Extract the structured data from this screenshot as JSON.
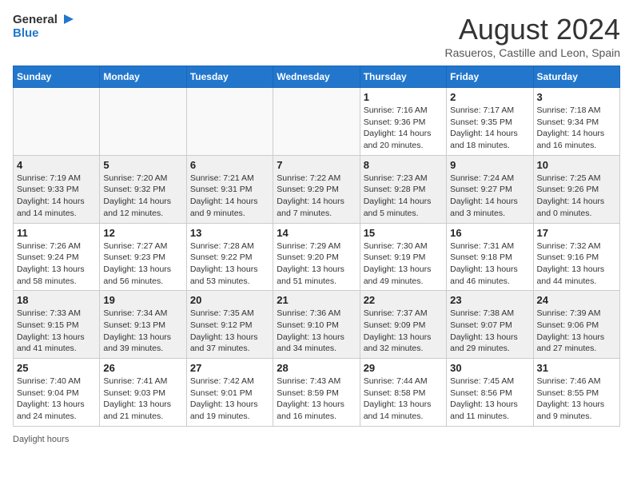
{
  "header": {
    "logo_general": "General",
    "logo_blue": "Blue",
    "month_year": "August 2024",
    "location": "Rasueros, Castille and Leon, Spain"
  },
  "days_of_week": [
    "Sunday",
    "Monday",
    "Tuesday",
    "Wednesday",
    "Thursday",
    "Friday",
    "Saturday"
  ],
  "weeks": [
    [
      {
        "day": "",
        "info": ""
      },
      {
        "day": "",
        "info": ""
      },
      {
        "day": "",
        "info": ""
      },
      {
        "day": "",
        "info": ""
      },
      {
        "day": "1",
        "info": "Sunrise: 7:16 AM\nSunset: 9:36 PM\nDaylight: 14 hours\nand 20 minutes."
      },
      {
        "day": "2",
        "info": "Sunrise: 7:17 AM\nSunset: 9:35 PM\nDaylight: 14 hours\nand 18 minutes."
      },
      {
        "day": "3",
        "info": "Sunrise: 7:18 AM\nSunset: 9:34 PM\nDaylight: 14 hours\nand 16 minutes."
      }
    ],
    [
      {
        "day": "4",
        "info": "Sunrise: 7:19 AM\nSunset: 9:33 PM\nDaylight: 14 hours\nand 14 minutes."
      },
      {
        "day": "5",
        "info": "Sunrise: 7:20 AM\nSunset: 9:32 PM\nDaylight: 14 hours\nand 12 minutes."
      },
      {
        "day": "6",
        "info": "Sunrise: 7:21 AM\nSunset: 9:31 PM\nDaylight: 14 hours\nand 9 minutes."
      },
      {
        "day": "7",
        "info": "Sunrise: 7:22 AM\nSunset: 9:29 PM\nDaylight: 14 hours\nand 7 minutes."
      },
      {
        "day": "8",
        "info": "Sunrise: 7:23 AM\nSunset: 9:28 PM\nDaylight: 14 hours\nand 5 minutes."
      },
      {
        "day": "9",
        "info": "Sunrise: 7:24 AM\nSunset: 9:27 PM\nDaylight: 14 hours\nand 3 minutes."
      },
      {
        "day": "10",
        "info": "Sunrise: 7:25 AM\nSunset: 9:26 PM\nDaylight: 14 hours\nand 0 minutes."
      }
    ],
    [
      {
        "day": "11",
        "info": "Sunrise: 7:26 AM\nSunset: 9:24 PM\nDaylight: 13 hours\nand 58 minutes."
      },
      {
        "day": "12",
        "info": "Sunrise: 7:27 AM\nSunset: 9:23 PM\nDaylight: 13 hours\nand 56 minutes."
      },
      {
        "day": "13",
        "info": "Sunrise: 7:28 AM\nSunset: 9:22 PM\nDaylight: 13 hours\nand 53 minutes."
      },
      {
        "day": "14",
        "info": "Sunrise: 7:29 AM\nSunset: 9:20 PM\nDaylight: 13 hours\nand 51 minutes."
      },
      {
        "day": "15",
        "info": "Sunrise: 7:30 AM\nSunset: 9:19 PM\nDaylight: 13 hours\nand 49 minutes."
      },
      {
        "day": "16",
        "info": "Sunrise: 7:31 AM\nSunset: 9:18 PM\nDaylight: 13 hours\nand 46 minutes."
      },
      {
        "day": "17",
        "info": "Sunrise: 7:32 AM\nSunset: 9:16 PM\nDaylight: 13 hours\nand 44 minutes."
      }
    ],
    [
      {
        "day": "18",
        "info": "Sunrise: 7:33 AM\nSunset: 9:15 PM\nDaylight: 13 hours\nand 41 minutes."
      },
      {
        "day": "19",
        "info": "Sunrise: 7:34 AM\nSunset: 9:13 PM\nDaylight: 13 hours\nand 39 minutes."
      },
      {
        "day": "20",
        "info": "Sunrise: 7:35 AM\nSunset: 9:12 PM\nDaylight: 13 hours\nand 37 minutes."
      },
      {
        "day": "21",
        "info": "Sunrise: 7:36 AM\nSunset: 9:10 PM\nDaylight: 13 hours\nand 34 minutes."
      },
      {
        "day": "22",
        "info": "Sunrise: 7:37 AM\nSunset: 9:09 PM\nDaylight: 13 hours\nand 32 minutes."
      },
      {
        "day": "23",
        "info": "Sunrise: 7:38 AM\nSunset: 9:07 PM\nDaylight: 13 hours\nand 29 minutes."
      },
      {
        "day": "24",
        "info": "Sunrise: 7:39 AM\nSunset: 9:06 PM\nDaylight: 13 hours\nand 27 minutes."
      }
    ],
    [
      {
        "day": "25",
        "info": "Sunrise: 7:40 AM\nSunset: 9:04 PM\nDaylight: 13 hours\nand 24 minutes."
      },
      {
        "day": "26",
        "info": "Sunrise: 7:41 AM\nSunset: 9:03 PM\nDaylight: 13 hours\nand 21 minutes."
      },
      {
        "day": "27",
        "info": "Sunrise: 7:42 AM\nSunset: 9:01 PM\nDaylight: 13 hours\nand 19 minutes."
      },
      {
        "day": "28",
        "info": "Sunrise: 7:43 AM\nSunset: 8:59 PM\nDaylight: 13 hours\nand 16 minutes."
      },
      {
        "day": "29",
        "info": "Sunrise: 7:44 AM\nSunset: 8:58 PM\nDaylight: 13 hours\nand 14 minutes."
      },
      {
        "day": "30",
        "info": "Sunrise: 7:45 AM\nSunset: 8:56 PM\nDaylight: 13 hours\nand 11 minutes."
      },
      {
        "day": "31",
        "info": "Sunrise: 7:46 AM\nSunset: 8:55 PM\nDaylight: 13 hours\nand 9 minutes."
      }
    ]
  ],
  "footer": {
    "daylight_label": "Daylight hours"
  }
}
